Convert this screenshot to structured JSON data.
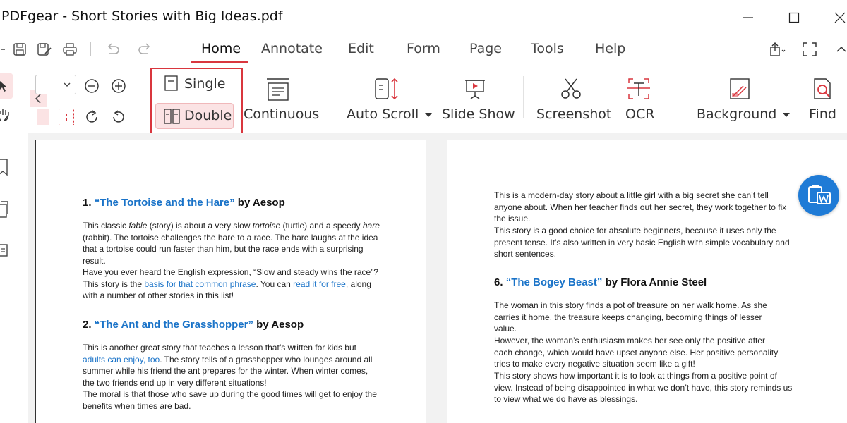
{
  "window": {
    "title": "PDFgear - Short Stories with Big Ideas.pdf"
  },
  "menu": {
    "tabs": [
      "Home",
      "Annotate",
      "Edit",
      "Form",
      "Page",
      "Tools",
      "Help"
    ],
    "active": "Home"
  },
  "ribbon": {
    "single_label": "Single",
    "double_label": "Double",
    "continuous_label": "Continuous",
    "autoscroll_label": "Auto Scroll",
    "slideshow_label": "Slide Show",
    "screenshot_label": "Screenshot",
    "ocr_label": "OCR",
    "background_label": "Background",
    "find_label": "Find"
  },
  "colors": {
    "accent": "#d9363e",
    "link": "#1a73c8",
    "fab": "#1f7bd6",
    "selected_bg": "#fbe3e4"
  },
  "page_left": {
    "story1": {
      "number": "1.",
      "title": "“The Tortoise and the Hare”",
      "author": "by Aesop",
      "p1": [
        "This classic ",
        "fable",
        " (story) is about a very slow ",
        "tortoise",
        " (turtle) and a speedy ",
        "hare",
        " (rabbit). The tortoise challenges the hare to a race. The hare laughs at the idea that a tortoise could run faster than him, but the race ends with a surprising result."
      ],
      "p2": [
        "Have you ever heard the English expression, “Slow and steady wins the race”? This story is the ",
        "basis for that common phrase",
        ". You can ",
        "read it for free",
        ", along with a number of other stories in this list!"
      ]
    },
    "story2": {
      "number": "2.",
      "title": "“The Ant and the Grasshopper”",
      "author": "by Aesop",
      "p1": [
        "This is another great story that teaches a lesson that’s written for kids but ",
        "adults can enjoy, too",
        ". The story tells of a grasshopper who lounges around all summer while his friend the ant prepares for the winter. When winter comes, the two friends end up in very different situations!"
      ],
      "p2": "The moral is that those who save up during the good times will get to enjoy the benefits when times are bad."
    }
  },
  "page_right": {
    "p1": "This is a modern-day story about a little girl with a big secret she can’t tell anyone about. When her teacher finds out her secret, they work together to fix the issue.",
    "p2": "This story is a good choice for absolute beginners, because it uses only the present tense. It’s also written in very basic English with simple vocabulary and short sentences.",
    "story6": {
      "number": "6.",
      "title": "“The Bogey Beast”",
      "author": "by Flora Annie Steel",
      "p1": "The woman in this story finds a pot of treasure on her walk home. As she carries it home, the treasure keeps changing, becoming things of lesser value.",
      "p2": "However, the woman’s enthusiasm makes her see only the positive after each change, which would have upset anyone else. Her positive personality tries to make every negative situation seem like a gift!",
      "p3": "This story shows how important it is to look at things from a positive point of view. Instead of being disappointed in what we don’t have, this story reminds us to view what we do have as blessings."
    }
  },
  "icons": [
    "save-icon",
    "save-as-icon",
    "print-icon",
    "undo-icon",
    "redo-icon",
    "share-icon",
    "fullscreen-icon",
    "collapse-icon",
    "pdf-to-word-icon"
  ]
}
